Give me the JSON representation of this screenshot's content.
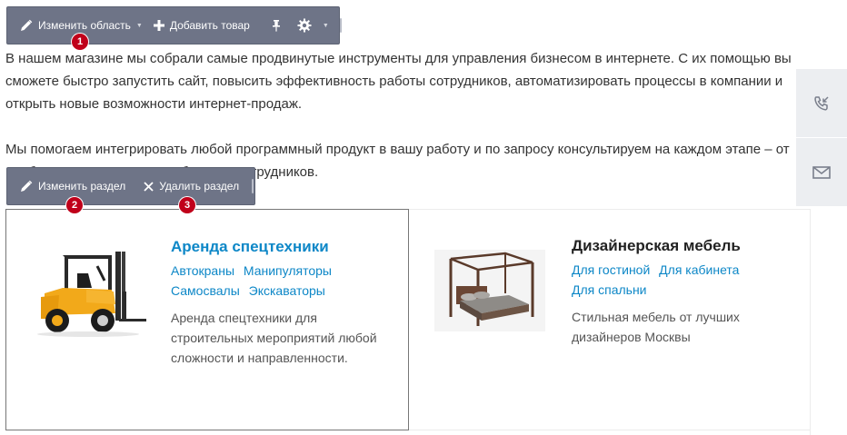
{
  "toolbar_area": {
    "edit_area_label": "Изменить область",
    "add_product_label": "Добавить товар"
  },
  "toolbar_section": {
    "edit_section_label": "Изменить раздел",
    "delete_section_label": "Удалить раздел"
  },
  "markers": [
    "1",
    "2",
    "3"
  ],
  "intro": {
    "paragraph1": "В нашем магазине мы собрали самые продвинутые инструменты для управления бизнесом в интернете. С их помощью вы сможете быстро запустить сайт, повысить эффективность работы сотрудников, автоматизировать процессы в компании и открыть новые возможности интернет-продаж.",
    "paragraph2": "Мы помогаем интегрировать любой программный продукт в вашу работу и по запросу консультируем на каждом этапе – от подбора инструментов до обучения сотрудников."
  },
  "side_bar": {
    "icons": [
      "phone-callback-icon",
      "mail-icon"
    ]
  },
  "categories": [
    {
      "title": "Аренда спецтехники",
      "links": [
        [
          "Автокраны",
          "Манипуляторы"
        ],
        [
          "Самосвалы",
          "Экскаваторы"
        ]
      ],
      "description": "Аренда спецтехники для строительных мероприятий любой сложности и направленности.",
      "image_icon": "forklift-image"
    },
    {
      "title": "Дизайнерская мебель",
      "links": [
        [
          "Для гостиной",
          "Для кабинета"
        ],
        [
          "Для спальни"
        ]
      ],
      "description": "Стильная мебель от лучших дизайнеров Москвы",
      "image_icon": "canopy-bed-image"
    }
  ],
  "colors": {
    "toolbar_bg": "#6e7487",
    "marker": "#c0001a",
    "link": "#0d87c7",
    "side_bar_bg": "#eceef1"
  }
}
